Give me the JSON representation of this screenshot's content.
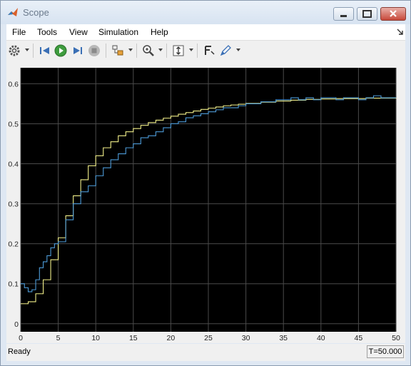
{
  "window": {
    "title": "Scope"
  },
  "menu": {
    "items": [
      "File",
      "Tools",
      "View",
      "Simulation",
      "Help"
    ]
  },
  "toolbar": {
    "icons": [
      "gear-icon",
      "step-back-icon",
      "run-icon",
      "step-forward-icon",
      "stop-icon",
      "signal-selector-icon",
      "zoom-icon",
      "autoscale-icon",
      "cursor-icon",
      "highlight-icon"
    ]
  },
  "colors": {
    "plot_bg": "#000000",
    "grid": "#4a4a4a",
    "series_blue": "#4d9bd8",
    "series_yellow": "#f2f08a"
  },
  "status": {
    "text": "Ready",
    "time": "T=50.000"
  },
  "chart_data": {
    "type": "line",
    "xlim": [
      0,
      50
    ],
    "ylim": [
      -0.02,
      0.64
    ],
    "xticks": [
      0,
      5,
      10,
      15,
      20,
      25,
      30,
      35,
      40,
      45,
      50
    ],
    "yticks": [
      0,
      0.1,
      0.2,
      0.3,
      0.4,
      0.5,
      0.6
    ],
    "grid": true,
    "series": [
      {
        "color": "#f2f08a",
        "x": [
          0,
          1,
          2,
          3,
          4,
          5,
          6,
          7,
          8,
          9,
          10,
          11,
          12,
          13,
          14,
          15,
          16,
          17,
          18,
          19,
          20,
          21,
          22,
          23,
          24,
          25,
          26,
          27,
          28,
          29,
          30,
          32,
          34,
          36,
          38,
          40,
          42,
          44,
          46,
          48,
          50
        ],
        "values": [
          0.05,
          0.055,
          0.075,
          0.11,
          0.16,
          0.215,
          0.27,
          0.32,
          0.36,
          0.395,
          0.42,
          0.44,
          0.455,
          0.47,
          0.48,
          0.488,
          0.496,
          0.503,
          0.509,
          0.514,
          0.519,
          0.524,
          0.528,
          0.532,
          0.536,
          0.539,
          0.542,
          0.545,
          0.547,
          0.549,
          0.551,
          0.554,
          0.557,
          0.559,
          0.561,
          0.562,
          0.563,
          0.563,
          0.564,
          0.564,
          0.565
        ]
      },
      {
        "color": "#4d9bd8",
        "x": [
          0,
          0.5,
          1,
          1.5,
          2,
          2.5,
          3,
          3.5,
          4,
          4.5,
          5,
          6,
          7,
          8,
          9,
          10,
          11,
          12,
          13,
          14,
          15,
          16,
          17,
          18,
          19,
          20,
          21,
          22,
          23,
          24,
          25,
          26,
          27,
          28,
          29,
          30,
          31,
          32,
          33,
          34,
          35,
          36,
          37,
          38,
          39,
          40,
          41,
          42,
          43,
          44,
          45,
          46,
          47,
          48,
          49,
          50
        ],
        "values": [
          0.1,
          0.09,
          0.08,
          0.085,
          0.11,
          0.14,
          0.155,
          0.17,
          0.19,
          0.2,
          0.205,
          0.26,
          0.3,
          0.33,
          0.345,
          0.37,
          0.39,
          0.41,
          0.425,
          0.44,
          0.45,
          0.465,
          0.47,
          0.48,
          0.49,
          0.5,
          0.505,
          0.515,
          0.52,
          0.525,
          0.53,
          0.535,
          0.54,
          0.54,
          0.545,
          0.55,
          0.55,
          0.555,
          0.555,
          0.56,
          0.56,
          0.565,
          0.56,
          0.565,
          0.56,
          0.565,
          0.565,
          0.56,
          0.565,
          0.565,
          0.56,
          0.565,
          0.57,
          0.565,
          0.565,
          0.565
        ]
      }
    ]
  }
}
